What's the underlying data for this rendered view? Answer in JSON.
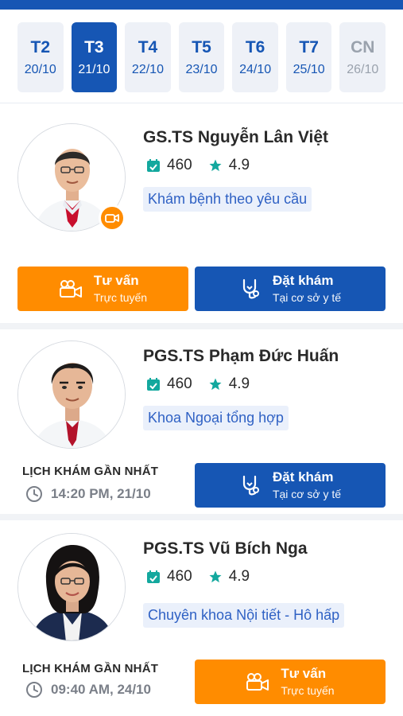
{
  "days": [
    {
      "label": "T2",
      "date": "20/10"
    },
    {
      "label": "T3",
      "date": "21/10"
    },
    {
      "label": "T4",
      "date": "22/10"
    },
    {
      "label": "T5",
      "date": "23/10"
    },
    {
      "label": "T6",
      "date": "24/10"
    },
    {
      "label": "T7",
      "date": "25/10"
    },
    {
      "label": "CN",
      "date": "26/10"
    }
  ],
  "doctors": [
    {
      "name": "GS.TS Nguyễn Lân Việt",
      "count": "460",
      "rating": "4.9",
      "specialty": "Khám bệnh theo yêu cầu",
      "consult_title": "Tư vấn",
      "consult_sub": "Trực tuyến",
      "book_title": "Đặt khám",
      "book_sub": "Tại cơ sở y tế"
    },
    {
      "name": "PGS.TS Phạm Đức Huấn",
      "count": "460",
      "rating": "4.9",
      "specialty": "Khoa Ngoại tổng hợp",
      "schedule_label": "LỊCH KHÁM GẦN NHẤT",
      "schedule_time": "14:20 PM, 21/10",
      "book_title": "Đặt khám",
      "book_sub": "Tại cơ sở y tế"
    },
    {
      "name": "PGS.TS Vũ Bích Nga",
      "count": "460",
      "rating": "4.9",
      "specialty": "Chuyên khoa Nội tiết - Hô hấp",
      "schedule_label": "LỊCH KHÁM GẦN NHẤT",
      "schedule_time": "09:40 AM, 24/10",
      "consult_title": "Tư vấn",
      "consult_sub": "Trực tuyến"
    }
  ],
  "colors": {
    "primary": "#1656b4",
    "accent": "#ff8c00",
    "star": "#13a89e"
  },
  "icons": [
    "calendar-check-icon",
    "star-icon",
    "video-camera-icon",
    "stethoscope-icon",
    "clock-icon"
  ]
}
